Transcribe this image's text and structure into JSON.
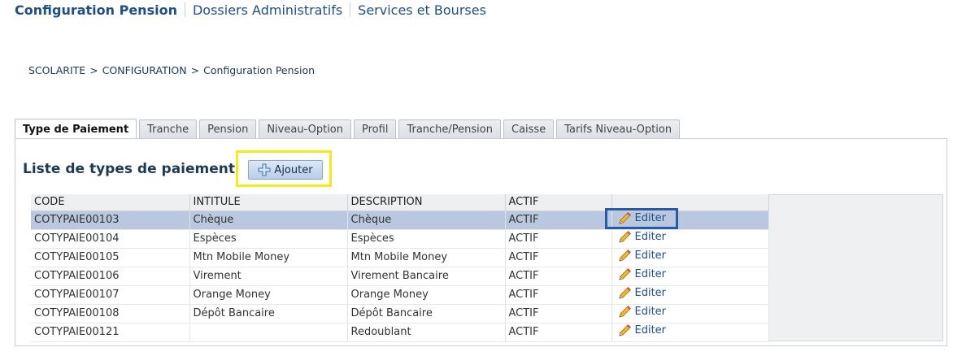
{
  "topnav": {
    "items": [
      {
        "label": "Configuration Pension",
        "active": true
      },
      {
        "label": "Dossiers Administratifs",
        "active": false
      },
      {
        "label": "Services et Bourses",
        "active": false
      }
    ]
  },
  "breadcrumb": {
    "items": [
      "SCOLARITE",
      "CONFIGURATION",
      "Configuration Pension"
    ],
    "separator": ">"
  },
  "tabs": [
    {
      "label": "Type de Paiement",
      "active": true
    },
    {
      "label": "Tranche",
      "active": false
    },
    {
      "label": "Pension",
      "active": false
    },
    {
      "label": "Niveau-Option",
      "active": false
    },
    {
      "label": "Profil",
      "active": false
    },
    {
      "label": "Tranche/Pension",
      "active": false
    },
    {
      "label": "Caisse",
      "active": false
    },
    {
      "label": "Tarifs Niveau-Option",
      "active": false
    }
  ],
  "main": {
    "title": "Liste de types de paiement",
    "add_button_label": "Ajouter",
    "edit_label": "Editer",
    "columns": [
      "CODE",
      "INTITULE",
      "DESCRIPTION",
      "ACTIF",
      ""
    ],
    "rows": [
      {
        "code": "COTYPAIE00103",
        "intitule": "Chèque",
        "description": "Chèque",
        "actif": "ACTIF",
        "selected": true
      },
      {
        "code": "COTYPAIE00104",
        "intitule": "Espèces",
        "description": "Espèces",
        "actif": "ACTIF",
        "selected": false
      },
      {
        "code": "COTYPAIE00105",
        "intitule": "Mtn Mobile Money",
        "description": "Mtn Mobile Money",
        "actif": "ACTIF",
        "selected": false
      },
      {
        "code": "COTYPAIE00106",
        "intitule": "Virement",
        "description": "Virement Bancaire",
        "actif": "ACTIF",
        "selected": false
      },
      {
        "code": "COTYPAIE00107",
        "intitule": "Orange Money",
        "description": "Orange Money",
        "actif": "ACTIF",
        "selected": false
      },
      {
        "code": "COTYPAIE00108",
        "intitule": "Dépôt Bancaire",
        "description": "Dépôt Bancaire",
        "actif": "ACTIF",
        "selected": false
      },
      {
        "code": "COTYPAIE00121",
        "intitule": "",
        "description": "Redoublant",
        "actif": "ACTIF",
        "selected": false
      }
    ]
  },
  "icons": {
    "add": "plus-icon",
    "edit": "pencil-icon"
  },
  "colors": {
    "accent_link": "#1f4e8c",
    "selected_row": "#b9c8de",
    "highlight_yellow": "#f5ea1a",
    "highlight_blue": "#2859a5"
  }
}
